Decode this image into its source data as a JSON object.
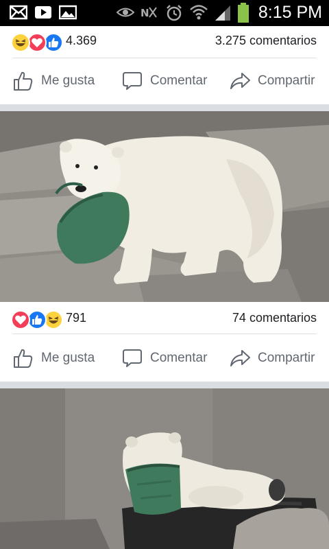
{
  "status_bar": {
    "time": "8:15 PM",
    "left_icons": [
      "mail-icon",
      "video-icon",
      "image-icon"
    ],
    "right_icons": [
      "eye-icon",
      "nfc-icon",
      "alarm-icon",
      "wifi-icon",
      "signal-icon",
      "battery-icon"
    ]
  },
  "posts": [
    {
      "reactions": [
        "haha",
        "love",
        "like"
      ],
      "reaction_count": "4.369",
      "comment_count": "3.275 comentarios",
      "actions": {
        "like": "Me gusta",
        "comment": "Comentar",
        "share": "Compartir"
      }
    },
    {
      "reactions": [
        "love",
        "like",
        "haha"
      ],
      "reaction_count": "791",
      "comment_count": "74 comentarios",
      "actions": {
        "like": "Me gusta",
        "comment": "Comentar",
        "share": "Compartir"
      }
    }
  ],
  "colors": {
    "brand_like": "#1877f2",
    "love": "#f33e58",
    "haha": "#fcd23e",
    "action_text": "#606770",
    "divider": "#dadde2"
  }
}
